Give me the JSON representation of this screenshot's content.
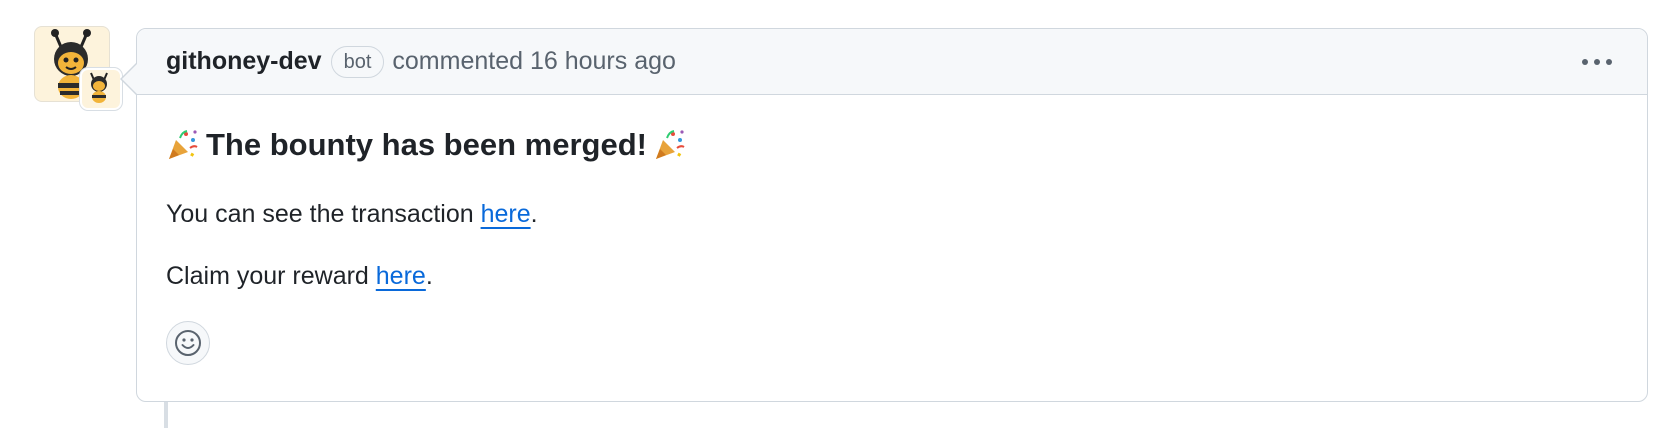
{
  "comment": {
    "author": "githoney-dev",
    "badge": "bot",
    "action": "commented",
    "timestamp": "16 hours ago",
    "heading_text": "The bounty has been merged!",
    "paragraphs": [
      {
        "prefix": "You can see the transaction ",
        "link_text": "here",
        "suffix": "."
      },
      {
        "prefix": "Claim your reward ",
        "link_text": "here",
        "suffix": "."
      }
    ]
  },
  "icons": {
    "avatar": "bee-avatar-icon",
    "avatar_badge": "bee-app-badge-icon",
    "heading_emoji": "party-popper-icon",
    "more": "kebab-menu-icon",
    "reaction": "smiley-icon"
  },
  "colors": {
    "link": "#0969da",
    "header_bg": "#f6f8fa",
    "border": "#d0d7de",
    "muted_text": "#59636e"
  }
}
